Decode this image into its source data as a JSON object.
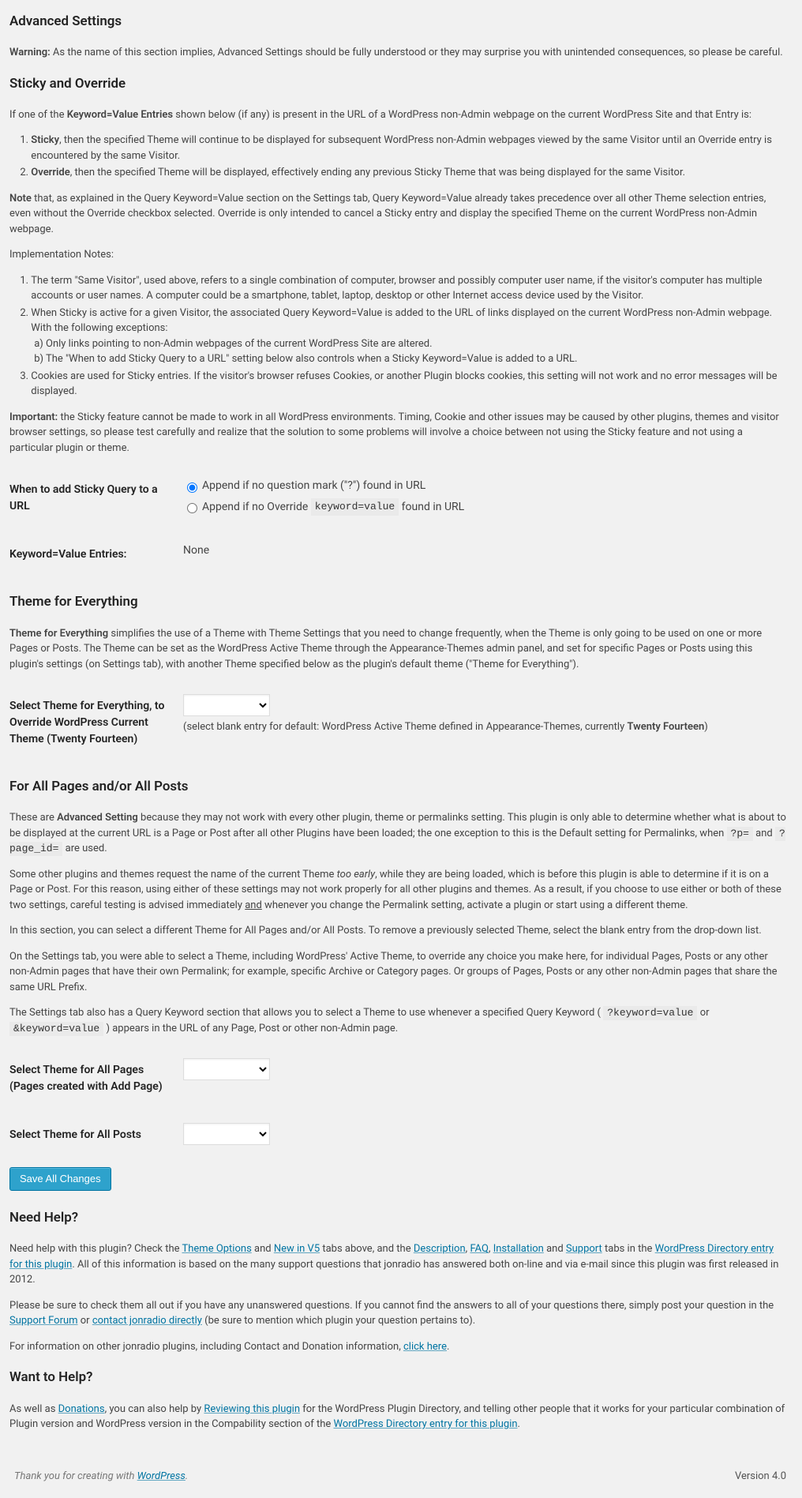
{
  "h_advanced": "Advanced Settings",
  "warn_label": "Warning:",
  "warn_text": " As the name of this section implies, Advanced Settings should be fully understood or they may surprise you with unintended consequences, so please be careful.",
  "h_sticky": "Sticky and Override",
  "sticky_intro_1": "If one of the ",
  "sticky_intro_bold": "Keyword=Value Entries",
  "sticky_intro_2": " shown below (if any) is present in the URL of a WordPress non-Admin webpage on the current WordPress Site and that Entry is:",
  "li_sticky_b": "Sticky",
  "li_sticky_t": ", then the specified Theme will continue to be displayed for subsequent WordPress non-Admin webpages viewed by the same Visitor until an Override entry is encountered by the same Visitor.",
  "li_override_b": "Override",
  "li_override_t": ", then the specified Theme will be displayed, effectively ending any previous Sticky Theme that was being displayed for the same Visitor.",
  "note_b": "Note",
  "note_t": " that, as explained in the Query Keyword=Value section on the Settings tab, Query Keyword=Value already takes precedence over all other Theme selection entries, even without the Override checkbox selected. Override is only intended to cancel a Sticky entry and display the specified Theme on the current WordPress non-Admin webpage.",
  "impl_notes": "Implementation Notes:",
  "impl_li1": "The term \"Same Visitor\", used above, refers to a single combination of computer, browser and possibly computer user name, if the visitor's computer has multiple accounts or user names. A computer could be a smartphone, tablet, laptop, desktop or other Internet access device used by the Visitor.",
  "impl_li2": "When Sticky is active for a given Visitor, the associated Query Keyword=Value is added to the URL of links displayed on the current WordPress non-Admin webpage. With the following exceptions:",
  "impl_li2a": "a) Only links pointing to non-Admin webpages of the current WordPress Site are altered.",
  "impl_li2b": "b) The \"When to add Sticky Query to a URL\" setting below also controls when a Sticky Keyword=Value is added to a URL.",
  "impl_li3": "Cookies are used for Sticky entries. If the visitor's browser refuses Cookies, or another Plugin blocks cookies, this setting will not work and no error messages will be displayed.",
  "important_b": "Important:",
  "important_t": " the Sticky feature cannot be made to work in all WordPress environments. Timing, Cookie and other issues may be caused by other plugins, themes and visitor browser settings, so please test carefully and realize that the solution to some problems will involve a choice between not using the Sticky feature and not using a particular plugin or theme.",
  "lbl_when_add": "When to add Sticky Query to a URL",
  "opt_append_q": "Append if no question mark (\"?\") found in URL",
  "opt_append_o1": "Append if no Override ",
  "opt_append_code": "keyword=value",
  "opt_append_o2": " found in URL",
  "lbl_kv_entries": "Keyword=Value Entries:",
  "val_none": "None",
  "h_theme_every": "Theme for Everything",
  "te_b": "Theme for Everything",
  "te_t": " simplifies the use of a Theme with Theme Settings that you need to change frequently, when the Theme is only going to be used on one or more Pages or Posts. The Theme can be set as the WordPress Active Theme through the Appearance-Themes admin panel, and set for specific Pages or Posts using this plugin's settings (on Settings tab), with another Theme specified below as the plugin's default theme (\"Theme for Everything\").",
  "lbl_select_te": "Select Theme for Everything, to Override WordPress Current Theme (Twenty Fourteen)",
  "te_desc1": "(select blank entry for default: WordPress Active Theme defined in Appearance-Themes, currently ",
  "te_desc_b": "Twenty Fourteen",
  "te_desc2": ")",
  "h_allpages": "For All Pages and/or All Posts",
  "ap_p1a": "These are ",
  "ap_p1b": "Advanced Setting",
  "ap_p1c": " because they may not work with every other plugin, theme or permalinks setting. This plugin is only able to determine whether what is about to be displayed at the current URL is a Page or Post after all other Plugins have been loaded; the one exception to this is the Default setting for Permalinks, when ",
  "ap_code1": "?p=",
  "ap_p1d": " and ",
  "ap_code2": "?page_id=",
  "ap_p1e": " are used.",
  "ap_p2a": "Some other plugins and themes request the name of the current Theme ",
  "ap_p2i": "too early",
  "ap_p2b": ", while they are being loaded, which is before this plugin is able to determine if it is on a Page or Post. For this reason, using either of these settings may not work properly for all other plugins and themes. As a result, if you choose to use either or both of these two settings, careful testing is advised immediately ",
  "ap_p2u": "and",
  "ap_p2c": " whenever you change the Permalink setting, activate a plugin or start using a different theme.",
  "ap_p3": "In this section, you can select a different Theme for All Pages and/or All Posts. To remove a previously selected Theme, select the blank entry from the drop-down list.",
  "ap_p4": "On the Settings tab, you were able to select a Theme, including WordPress' Active Theme, to override any choice you make here, for individual Pages, Posts or any other non-Admin pages that have their own Permalink; for example, specific Archive or Category pages. Or groups of Pages, Posts or any other non-Admin pages that share the same URL Prefix.",
  "ap_p5a": "The Settings tab also has a Query Keyword section that allows you to select a Theme to use whenever a specified Query Keyword (",
  "ap_code3": "?keyword=value",
  "ap_p5b": " or ",
  "ap_code4": "&keyword=value",
  "ap_p5c": ") appears in the URL of any Page, Post or other non-Admin page.",
  "lbl_sel_allpages": "Select Theme for All Pages (Pages created with Add Page)",
  "lbl_sel_allposts": "Select Theme for All Posts",
  "btn_save": "Save All Changes",
  "h_needhelp": "Need Help?",
  "nh1a": "Need help with this plugin? Check the ",
  "nh_link1": "Theme Options",
  "nh1b": " and ",
  "nh_link2": "New in V5",
  "nh1c": " tabs above, and the ",
  "nh_link3": "Description",
  "nh1cs": ", ",
  "nh_link4": "FAQ",
  "nh_link5": "Installation",
  "nh1d": " and ",
  "nh_link6": "Support",
  "nh1e": " tabs in the ",
  "nh_link7": "WordPress Directory entry for this plugin",
  "nh1f": ". All of this information is based on the many support questions that jonradio has answered both on-line and via e-mail since this plugin was first released in 2012.",
  "nh2a": "Please be sure to check them all out if you have any unanswered questions. If you cannot find the answers to all of your questions there, simply post your question in the ",
  "nh_link8": "Support Forum",
  "nh2b": " or ",
  "nh_link9": "contact jonradio directly",
  "nh2c": " (be sure to mention which plugin your question pertains to).",
  "nh3a": "For information on other jonradio plugins, including Contact and Donation information, ",
  "nh_link10": "click here",
  "nh3b": ".",
  "h_wanthelp": "Want to Help?",
  "wh1a": "As well as ",
  "wh_link1": "Donations",
  "wh1b": ", you can also help by ",
  "wh_link2": "Reviewing this plugin",
  "wh1c": " for the WordPress Plugin Directory, and telling other people that it works for your particular combination of Plugin version and WordPress version in the Compability section of the ",
  "wh_link3": "WordPress Directory entry for this plugin",
  "wh1d": ".",
  "footer_a": "Thank you for creating with ",
  "footer_link": "WordPress",
  "footer_b": ".",
  "version": "Version 4.0"
}
